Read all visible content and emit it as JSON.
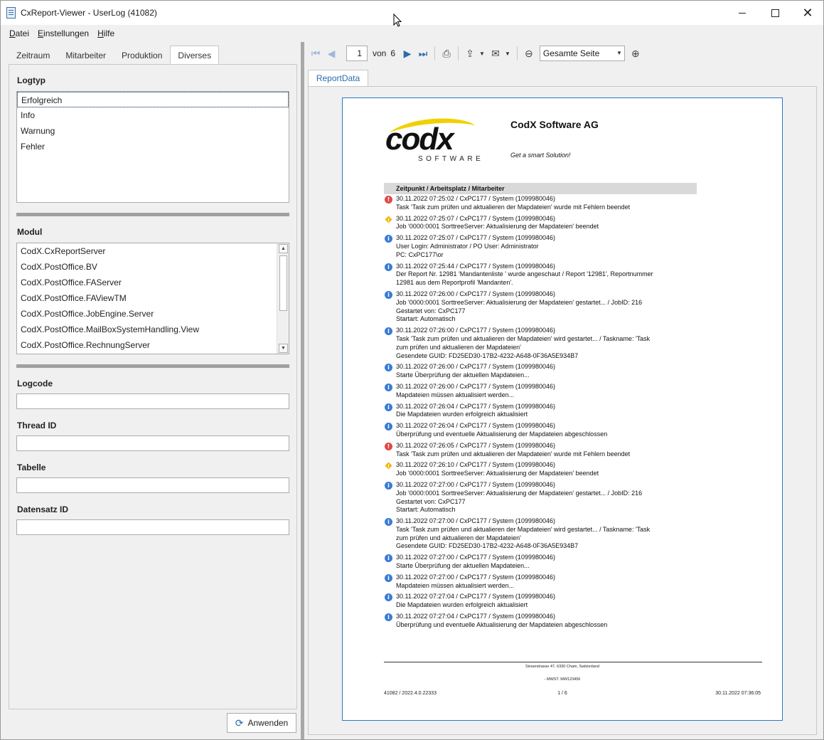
{
  "window": {
    "title": "CxReport-Viewer - UserLog (41082)",
    "minimize": "—",
    "maximize": "☐",
    "close": "✕"
  },
  "menu": [
    "Datei",
    "Einstellungen",
    "Hilfe"
  ],
  "left_tabs": [
    "Zeitraum",
    "Mitarbeiter",
    "Produktion",
    "Diverses"
  ],
  "active_left_tab": "Diverses",
  "logtyp": {
    "label": "Logtyp",
    "items": [
      "Erfolgreich",
      "Info",
      "Warnung",
      "Fehler"
    ],
    "selected": "Erfolgreich"
  },
  "modul": {
    "label": "Modul",
    "items": [
      "CodX.CxReportServer",
      "CodX.PostOffice.BV",
      "CodX.PostOffice.FAServer",
      "CodX.PostOffice.FAViewTM",
      "CodX.PostOffice.JobEngine.Server",
      "CodX.PostOffice.MailBoxSystemHandling.View",
      "CodX.PostOffice.RechnungServer"
    ]
  },
  "fields": {
    "logcode": {
      "label": "Logcode",
      "value": ""
    },
    "thread_id": {
      "label": "Thread ID",
      "value": ""
    },
    "tabelle": {
      "label": "Tabelle",
      "value": ""
    },
    "datensatz_id": {
      "label": "Datensatz ID",
      "value": ""
    }
  },
  "apply_button": "Anwenden",
  "toolbar": {
    "page": "1",
    "of_label": "von",
    "total_pages": "6",
    "zoom": "Gesamte Seite"
  },
  "report_tab": "ReportData",
  "report": {
    "company": "CodX Software AG",
    "slogan": "Get a smart Solution!",
    "logo_text": "codx",
    "logo_sub": "SOFTWARE",
    "column_header": "Zeitpunkt / Arbeitsplatz / Mitarbeiter",
    "entries": [
      {
        "type": "error",
        "lines": [
          "30.11.2022 07:25:02 / CxPC177 / System (1099980046)",
          "Task 'Task zum prüfen und aktualieren der Mapdateien' wurde mit Fehlern beendet"
        ]
      },
      {
        "type": "warn",
        "lines": [
          "30.11.2022 07:25:07 / CxPC177 / System (1099980046)",
          "Job '0000:0001 SorttreeServer: Aktualisierung der Mapdateien' beendet"
        ]
      },
      {
        "type": "info",
        "lines": [
          "30.11.2022 07:25:07 / CxPC177 / System (1099980046)",
          "User Login: Administrator / PO User: Administrator",
          "PC: CxPC177\\or"
        ]
      },
      {
        "type": "info",
        "lines": [
          "30.11.2022 07:25:44 / CxPC177 / System (1099980046)",
          "Der Report Nr. 12981 'Mandantenliste ' wurde angeschaut / Report '12981', Reportnummer",
          "12981 aus dem Reportprofil 'Mandanten'."
        ]
      },
      {
        "type": "info",
        "lines": [
          "30.11.2022 07:26:00 / CxPC177 / System (1099980046)",
          "Job '0000:0001 SorttreeServer: Aktualisierung der Mapdateien' gestartet... / JobID: 216",
          "Gestartet von: CxPC177",
          "Startart: Automatisch"
        ]
      },
      {
        "type": "info",
        "lines": [
          "30.11.2022 07:26:00 / CxPC177 / System (1099980046)",
          "Task 'Task zum prüfen und aktualieren der Mapdateien' wird gestartet... / Taskname: 'Task",
          "zum prüfen und aktualieren der Mapdateien'",
          "Gesendete GUID: FD25ED30-17B2-4232-A648-0F36A5E934B7"
        ]
      },
      {
        "type": "info",
        "lines": [
          "30.11.2022 07:26:00 / CxPC177 / System (1099980046)",
          "Starte Überprüfung der aktuellen Mapdateien..."
        ]
      },
      {
        "type": "info",
        "lines": [
          "30.11.2022 07:26:00 / CxPC177 / System (1099980046)",
          "Mapdateien müssen aktualisiert werden..."
        ]
      },
      {
        "type": "info",
        "lines": [
          "30.11.2022 07:26:04 / CxPC177 / System (1099980046)",
          "Die Mapdateien wurden erfolgreich aktualisiert"
        ]
      },
      {
        "type": "info",
        "lines": [
          "30.11.2022 07:26:04 / CxPC177 / System (1099980046)",
          "Überprüfung und eventuelle Aktualisierung der Mapdateien abgeschlossen"
        ]
      },
      {
        "type": "error",
        "lines": [
          "30.11.2022 07:26:05 / CxPC177 / System (1099980046)",
          "Task 'Task zum prüfen und aktualieren der Mapdateien' wurde mit Fehlern beendet"
        ]
      },
      {
        "type": "warn",
        "lines": [
          "30.11.2022 07:26:10 / CxPC177 / System (1099980046)",
          "Job '0000:0001 SorttreeServer: Aktualisierung der Mapdateien' beendet"
        ]
      },
      {
        "type": "info",
        "lines": [
          "30.11.2022 07:27:00 / CxPC177 / System (1099980046)",
          "Job '0000:0001 SorttreeServer: Aktualisierung der Mapdateien' gestartet... / JobID: 216",
          "Gestartet von: CxPC177",
          "Startart: Automatisch"
        ]
      },
      {
        "type": "info",
        "lines": [
          "30.11.2022 07:27:00 / CxPC177 / System (1099980046)",
          "Task 'Task zum prüfen und aktualieren der Mapdateien' wird gestartet... / Taskname: 'Task",
          "zum prüfen und aktualieren der Mapdateien'",
          "Gesendete GUID: FD25ED30-17B2-4232-A648-0F36A5E934B7"
        ]
      },
      {
        "type": "info",
        "lines": [
          "30.11.2022 07:27:00 / CxPC177 / System (1099980046)",
          "Starte Überprüfung der aktuellen Mapdateien..."
        ]
      },
      {
        "type": "info",
        "lines": [
          "30.11.2022 07:27:00 / CxPC177 / System (1099980046)",
          "Mapdateien müssen aktualisiert werden..."
        ]
      },
      {
        "type": "info",
        "lines": [
          "30.11.2022 07:27:04 / CxPC177 / System (1099980046)",
          "Die Mapdateien wurden erfolgreich aktualisiert"
        ]
      },
      {
        "type": "info",
        "lines": [
          "30.11.2022 07:27:04 / CxPC177 / System (1099980046)",
          "Überprüfung und eventuelle Aktualisierung der Mapdateien abgeschlossen"
        ]
      }
    ],
    "footer": {
      "address": "Sinserstrasse 47, 6330 Cham, Switzerland",
      "vat": "- MWST. MW123456",
      "left": "41082 / 2022.4.0.22333",
      "page": "1 / 6",
      "right": "30.11.2022 07:36:05"
    }
  },
  "colors": {
    "accent": "#2b6cb0",
    "info": "#3a7bd5",
    "error": "#e04848",
    "warn": "#f0b400",
    "logo_swoosh": "#f2d000"
  }
}
